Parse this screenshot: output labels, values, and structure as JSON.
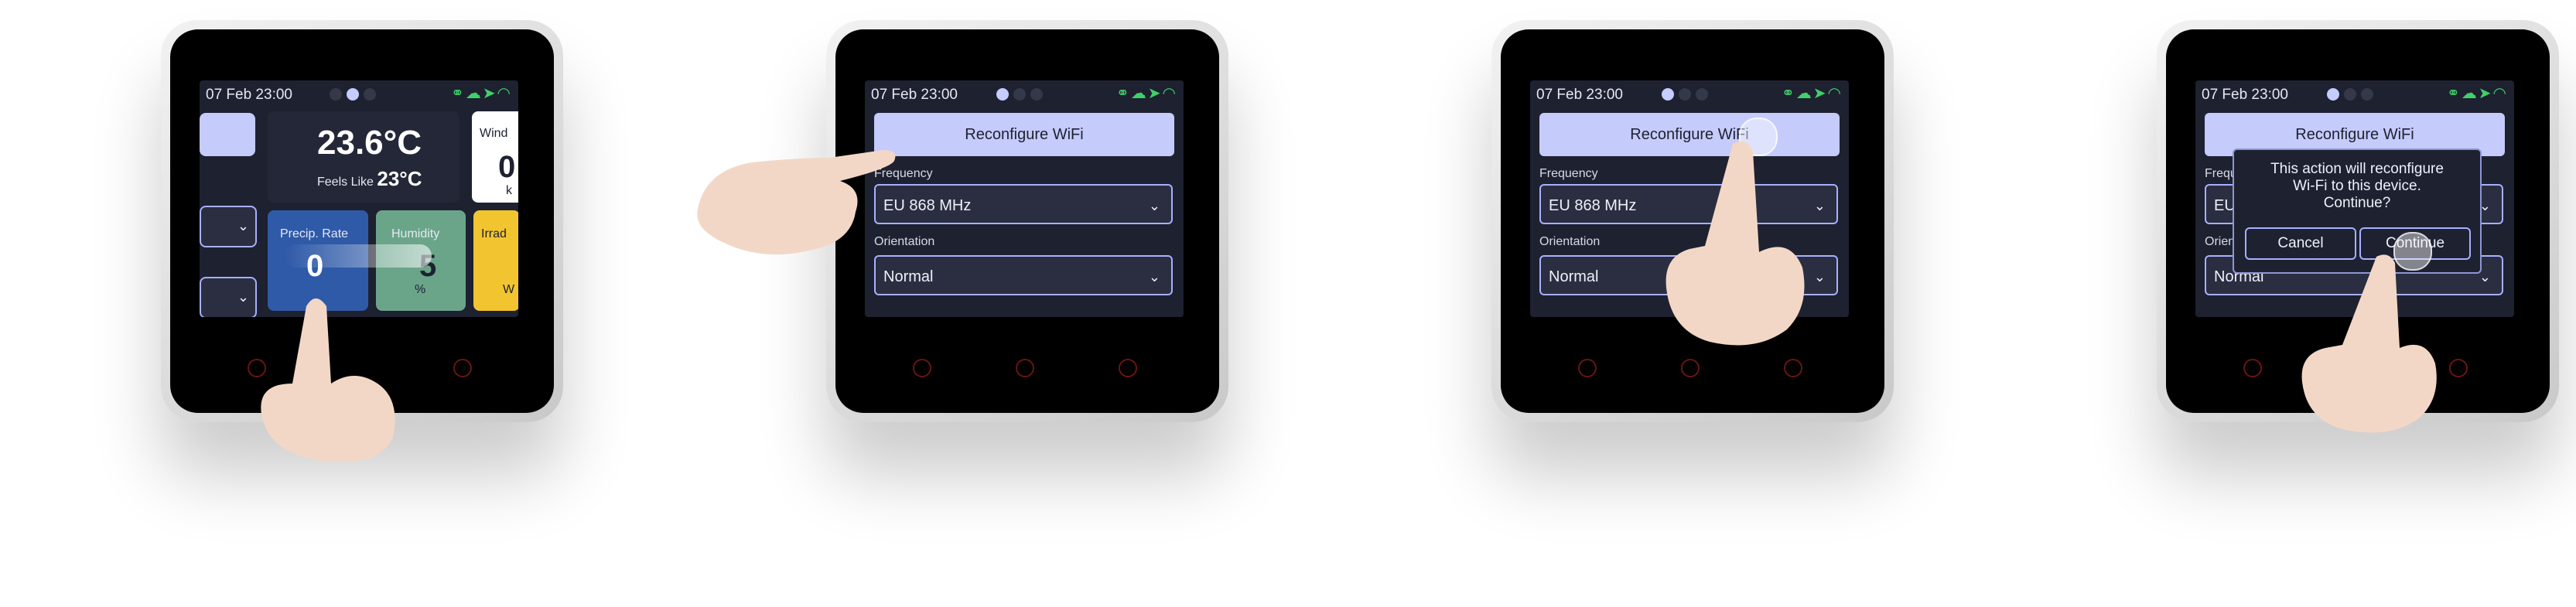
{
  "status": {
    "date_time": "07 Feb 23:00"
  },
  "status_icons": [
    "link-icon",
    "cloud-upload-icon",
    "location-arrow-icon",
    "wifi-icon"
  ],
  "colors": {
    "accent": "#c5cbfb",
    "status_green": "#3fd16a",
    "screen_bg": "#1e2130",
    "border": "#a7b0ff"
  },
  "weather": {
    "temperature": "23.6°C",
    "feels_like_label": "Feels Like",
    "feels_like_value": "23°C",
    "wind_label": "Wind",
    "wind_value": "0",
    "wind_unit": "k",
    "precip_label": "Precip. Rate",
    "precip_value": "0",
    "humidity_label": "Humidity",
    "humidity_value": "5",
    "humidity_unit": "%",
    "irradiance_label": "Irrad",
    "irradiance_unit": "W"
  },
  "settings": {
    "reconfigure_label": "Reconfigure WiFi",
    "frequency_label": "Frequency",
    "frequency_value": "EU 868 MHz",
    "orientation_label": "Orientation",
    "orientation_value": "Normal"
  },
  "dialog": {
    "message": "This action will reconfigure\nWi-Fi to this device.\nContinue?",
    "cancel_label": "Cancel",
    "continue_label": "Continue"
  }
}
